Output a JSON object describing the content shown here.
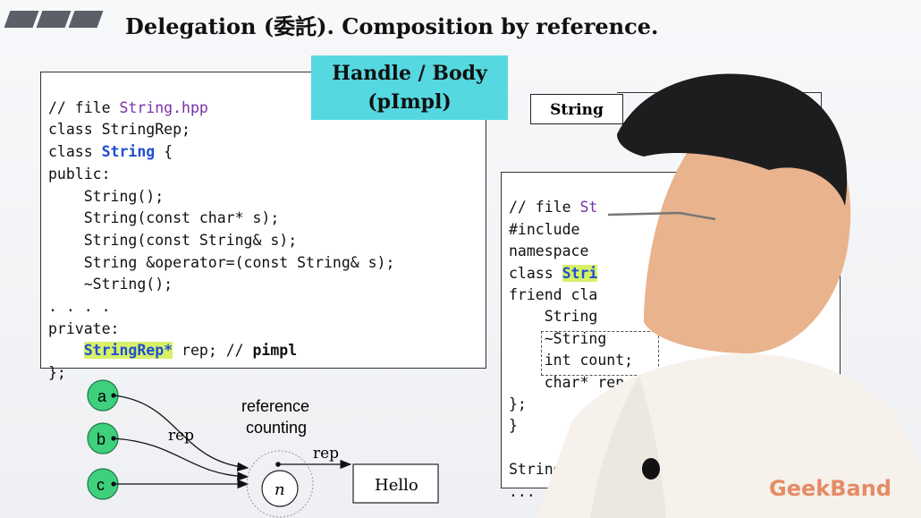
{
  "title": "Delegation (委託). Composition by reference.",
  "handle_body": {
    "line1": "Handle / Body",
    "line2": "(pImpl)"
  },
  "string_box_label": "String",
  "left_code": {
    "l1_prefix": "// file ",
    "l1_file": "String.hpp",
    "l2": "class StringRep;",
    "l3_prefix": "class ",
    "l3_name": "String",
    "l3_suffix": " {",
    "l4": "public:",
    "l5": "    String();",
    "l6": "    String(const char* s);",
    "l7": "    String(const String& s);",
    "l8": "    String &operator=(const String& s);",
    "l9": "    ~String();",
    "l10": ". . . .",
    "l11": "private:",
    "l12_indent": "    ",
    "l12_hl": "StringRep*",
    "l12_mid": " rep; // ",
    "l12_bold": "pimpl",
    "l13": "};"
  },
  "right_code": {
    "r1_prefix": "// file ",
    "r1_file": "St",
    "r2": "#include",
    "r3": "namespace",
    "r4_prefix": "class ",
    "r4_hl": "Stri",
    "r5": "friend cla",
    "r6": "    String",
    "r7": "    ~String",
    "r8": "    int count;",
    "r9": "    char* rep",
    "r10": "};",
    "r11": "}",
    "r12": "",
    "r13": "String:",
    "r14": "..."
  },
  "diagram": {
    "nodes": [
      "a",
      "b",
      "c"
    ],
    "rep_label": "rep",
    "rc_line1": "reference",
    "rc_line2": "counting",
    "count_node": "n",
    "rep_label2": "rep",
    "hello": "Hello"
  },
  "watermark": "GeekBand",
  "colors": {
    "node_fill": "#3fd07d",
    "handle_bg": "#55d8e0",
    "highlight": "#d7f16a"
  }
}
